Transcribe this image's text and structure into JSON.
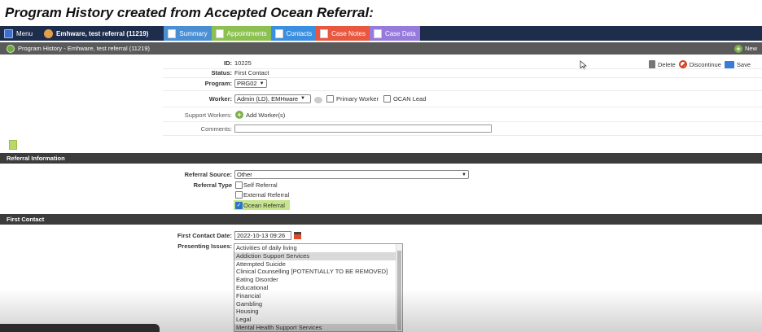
{
  "heading": "Program History created from Accepted Ocean Referral:",
  "topbar": {
    "menu_label": "Menu",
    "client_label": "Emhware, test referral (11219)",
    "tabs": [
      {
        "label": "Summary",
        "color": "#4a8fd4"
      },
      {
        "label": "Appointments",
        "color": "#8cc152"
      },
      {
        "label": "Contacts",
        "color": "#3b8fe0"
      },
      {
        "label": "Case Notes",
        "color": "#e9573f"
      },
      {
        "label": "Case Data",
        "color": "#967adc"
      }
    ]
  },
  "subbar": {
    "title": "Program History - Emhware, test referral (11219)",
    "new_label": "New"
  },
  "actions": {
    "delete_label": "Delete",
    "discontinue_label": "Discontinue",
    "save_label": "Save"
  },
  "form": {
    "id_label": "ID:",
    "id_value": "10225",
    "status_label": "Status:",
    "status_value": "First Contact",
    "program_label": "Program:",
    "program_value": "PRG02",
    "worker_label": "Worker:",
    "worker_value": "Admin (LD), EMHware",
    "primary_worker_label": "Primary Worker",
    "ocan_lead_label": "OCAN Lead",
    "support_workers_label": "Support Workers:",
    "add_worker_label": "Add Worker(s)",
    "comments_label": "Comments:"
  },
  "referral": {
    "section_title": "Referral Information",
    "source_label": "Referral Source:",
    "source_value": "Other",
    "type_label": "Referral Type",
    "types": [
      {
        "label": "Self Referral",
        "checked": false
      },
      {
        "label": "External Referral",
        "checked": false
      },
      {
        "label": "Ocean Referral",
        "checked": true
      }
    ]
  },
  "first_contact": {
    "section_title": "First Contact",
    "date_label": "First Contact Date:",
    "date_value": "2022-10-13 09:26",
    "issues_label": "Presenting Issues:",
    "issues": [
      {
        "label": "Activities of daily living",
        "selected": false
      },
      {
        "label": "Addiction Support Services",
        "selected": true
      },
      {
        "label": "Attempted Suicide",
        "selected": false
      },
      {
        "label": "Clinical Counselling [POTENTIALLY TO BE REMOVED]",
        "selected": false
      },
      {
        "label": "Eating Disorder",
        "selected": false
      },
      {
        "label": "Educational",
        "selected": false
      },
      {
        "label": "Financial",
        "selected": false
      },
      {
        "label": "Gambling",
        "selected": false
      },
      {
        "label": "Housing",
        "selected": false
      },
      {
        "label": "Legal",
        "selected": false
      },
      {
        "label": "Mental Health Support Services",
        "selected": true
      }
    ]
  }
}
